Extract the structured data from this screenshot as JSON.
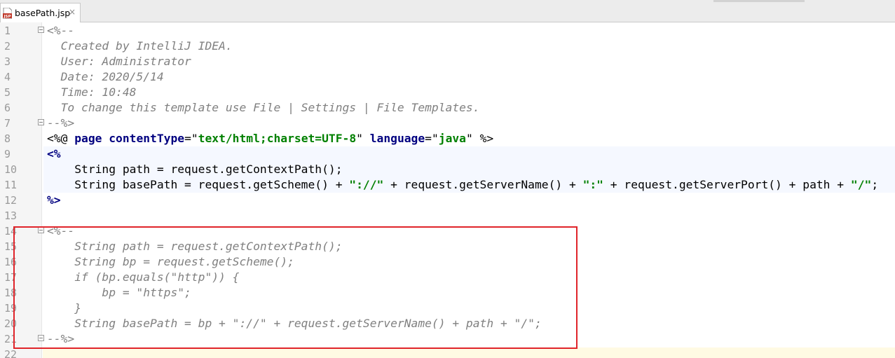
{
  "tab": {
    "file_name": "basePath.jsp",
    "close_icon": "×",
    "icon_label": "JSP"
  },
  "lines": [
    {
      "n": "1",
      "segs": [
        {
          "c": "cm",
          "t": "<%--"
        }
      ]
    },
    {
      "n": "2",
      "segs": [
        {
          "c": "cm",
          "t": "  Created by IntelliJ IDEA."
        }
      ]
    },
    {
      "n": "3",
      "segs": [
        {
          "c": "cm",
          "t": "  User: Administrator"
        }
      ]
    },
    {
      "n": "4",
      "segs": [
        {
          "c": "cm",
          "t": "  Date: 2020/5/14"
        }
      ]
    },
    {
      "n": "5",
      "segs": [
        {
          "c": "cm",
          "t": "  Time: 10:48"
        }
      ]
    },
    {
      "n": "6",
      "segs": [
        {
          "c": "cm",
          "t": "  To change this template use File | Settings | File Templates."
        }
      ]
    },
    {
      "n": "7",
      "segs": [
        {
          "c": "cm",
          "t": "--%>"
        }
      ]
    },
    {
      "n": "8",
      "segs": [
        {
          "c": "dq",
          "t": "<%@ "
        },
        {
          "c": "kw",
          "t": "page "
        },
        {
          "c": "kw",
          "t": "contentType"
        },
        {
          "c": "dq",
          "t": "=\""
        },
        {
          "c": "str",
          "t": "text/html;charset=UTF-8"
        },
        {
          "c": "dq",
          "t": "\" "
        },
        {
          "c": "kw",
          "t": "language"
        },
        {
          "c": "dq",
          "t": "=\""
        },
        {
          "c": "str",
          "t": "java"
        },
        {
          "c": "dq",
          "t": "\" %>"
        }
      ]
    },
    {
      "n": "9",
      "segs": [
        {
          "c": "kw",
          "t": "<%"
        }
      ]
    },
    {
      "n": "10",
      "segs": [
        {
          "c": "dq",
          "t": "    String path = request.getContextPath();"
        }
      ]
    },
    {
      "n": "11",
      "segs": [
        {
          "c": "dq",
          "t": "    String basePath = request.getScheme() + "
        },
        {
          "c": "str",
          "t": "\"://\""
        },
        {
          "c": "dq",
          "t": " + request.getServerName() + "
        },
        {
          "c": "str",
          "t": "\":\""
        },
        {
          "c": "dq",
          "t": " + request.getServerPort() + path + "
        },
        {
          "c": "str",
          "t": "\"/\""
        },
        {
          "c": "dq",
          "t": ";"
        }
      ]
    },
    {
      "n": "12",
      "segs": [
        {
          "c": "kw",
          "t": "%>"
        }
      ]
    },
    {
      "n": "13",
      "segs": []
    },
    {
      "n": "14",
      "segs": [
        {
          "c": "cm",
          "t": "<%--"
        }
      ]
    },
    {
      "n": "15",
      "segs": [
        {
          "c": "cm",
          "t": "    String path = request.getContextPath();"
        }
      ]
    },
    {
      "n": "16",
      "segs": [
        {
          "c": "cm",
          "t": "    String bp = request.getScheme();"
        }
      ]
    },
    {
      "n": "17",
      "segs": [
        {
          "c": "cm",
          "t": "    if (bp.equals(\"http\")) {"
        }
      ]
    },
    {
      "n": "18",
      "segs": [
        {
          "c": "cm",
          "t": "        bp = \"https\";"
        }
      ]
    },
    {
      "n": "19",
      "segs": [
        {
          "c": "cm",
          "t": "    }"
        }
      ]
    },
    {
      "n": "20",
      "segs": [
        {
          "c": "cm",
          "t": "    String basePath = bp + \"://\" + request.getServerName() + path + \"/\";"
        }
      ]
    },
    {
      "n": "21",
      "segs": [
        {
          "c": "cm",
          "t": "--%>"
        }
      ]
    },
    {
      "n": "22",
      "segs": []
    }
  ],
  "fold_markers": [
    "1",
    "7",
    "14",
    "21"
  ],
  "jsp_block_lines": [
    "9",
    "10",
    "11"
  ],
  "colors": {
    "comment": "#808080",
    "keyword": "#000080",
    "string": "#008000",
    "highlight_box": "#e0242a",
    "gutter": "#f5f5f5"
  }
}
